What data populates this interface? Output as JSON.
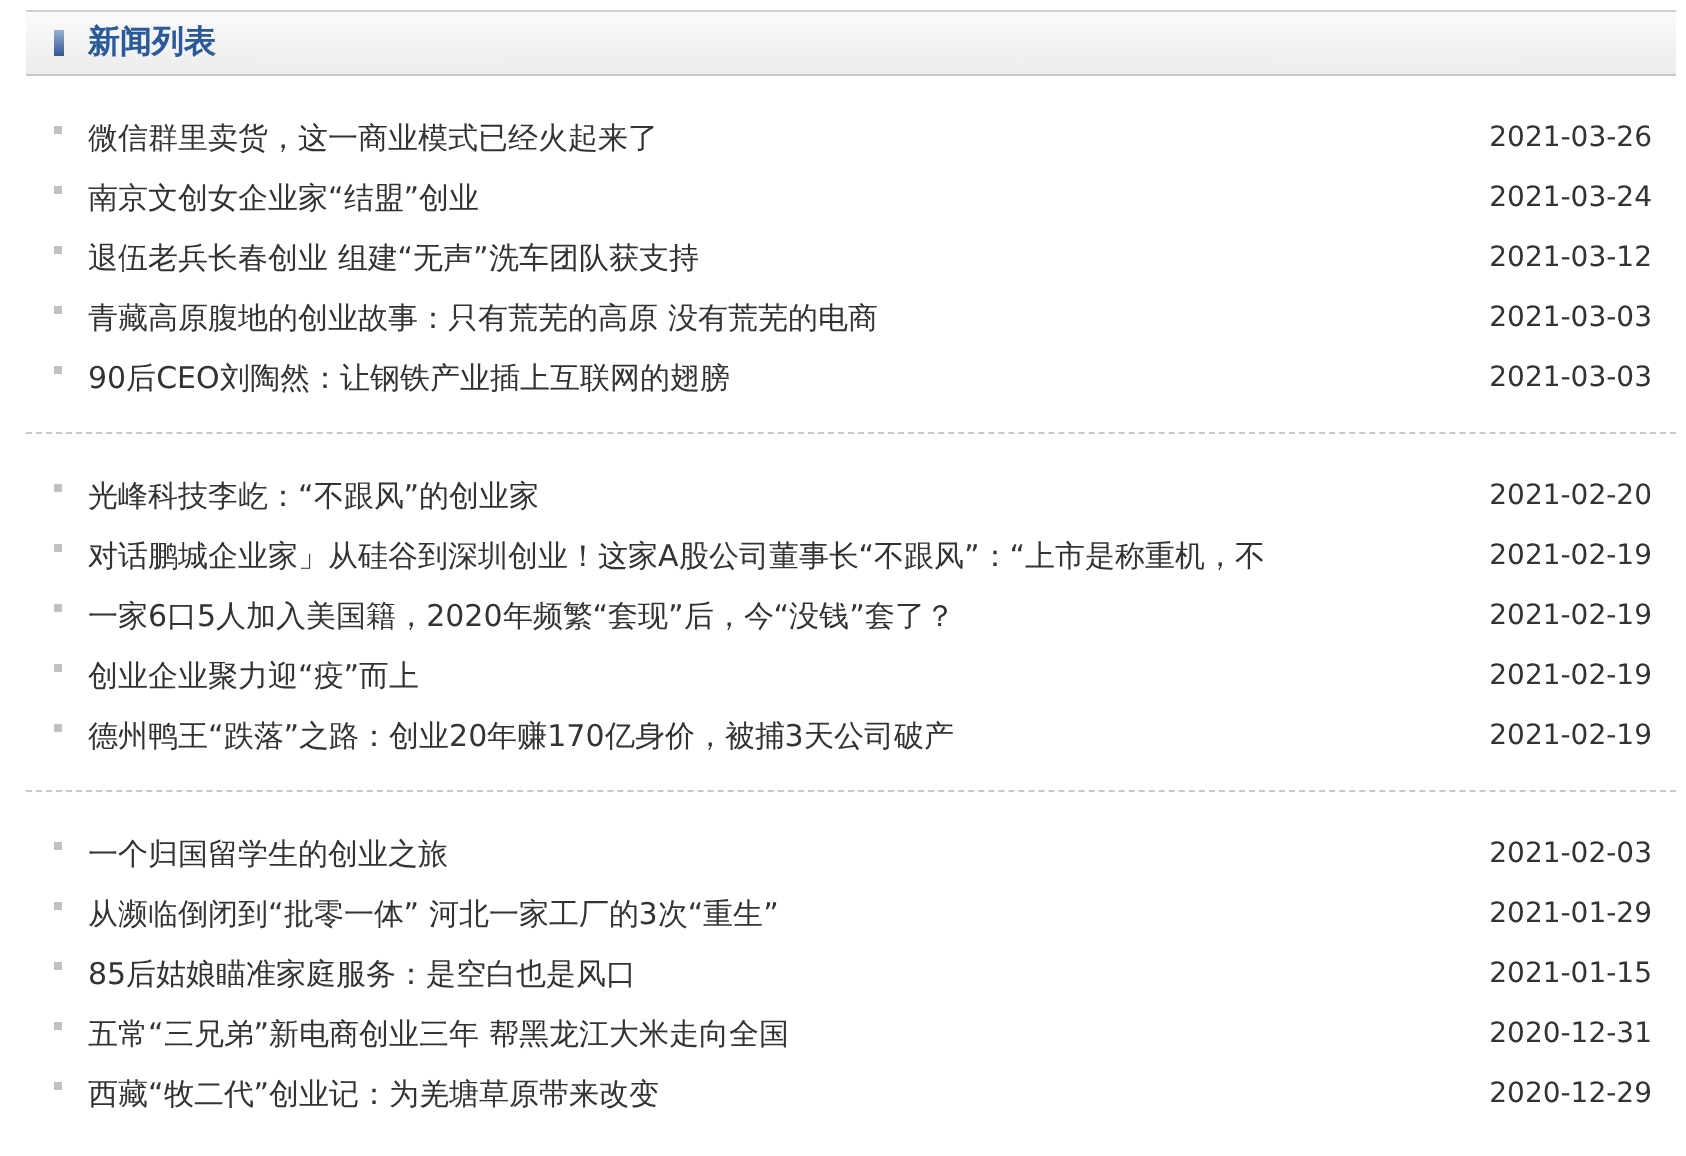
{
  "header": {
    "title": "新闻列表"
  },
  "groups": [
    {
      "items": [
        {
          "title": "微信群里卖货，这一商业模式已经火起来了",
          "date": "2021-03-26"
        },
        {
          "title": "南京文创女企业家“结盟”创业",
          "date": "2021-03-24"
        },
        {
          "title": "退伍老兵长春创业 组建“无声”洗车团队获支持",
          "date": "2021-03-12"
        },
        {
          "title": "青藏高原腹地的创业故事：只有荒芜的高原 没有荒芜的电商",
          "date": "2021-03-03"
        },
        {
          "title": "90后CEO刘陶然：让钢铁产业插上互联网的翅膀",
          "date": "2021-03-03"
        }
      ]
    },
    {
      "items": [
        {
          "title": "光峰科技李屹：“不跟风”的创业家",
          "date": "2021-02-20"
        },
        {
          "title": "对话鹏城企业家」从硅谷到深圳创业！这家A股公司董事长“不跟风”：“上市是称重机，不",
          "date": "2021-02-19"
        },
        {
          "title": "一家6口5人加入美国籍，2020年频繁“套现”后，今“没钱”套了？",
          "date": "2021-02-19"
        },
        {
          "title": "创业企业聚力迎“疫”而上",
          "date": "2021-02-19"
        },
        {
          "title": "德州鸭王“跌落”之路：创业20年赚170亿身价，被捕3天公司破产",
          "date": "2021-02-19"
        }
      ]
    },
    {
      "items": [
        {
          "title": "一个归国留学生的创业之旅",
          "date": "2021-02-03"
        },
        {
          "title": "从濒临倒闭到“批零一体” 河北一家工厂的3次“重生”",
          "date": "2021-01-29"
        },
        {
          "title": "85后姑娘瞄准家庭服务：是空白也是风口",
          "date": "2021-01-15"
        },
        {
          "title": "五常“三兄弟”新电商创业三年 帮黑龙江大米走向全国",
          "date": "2020-12-31"
        },
        {
          "title": "西藏“牧二代”创业记：为羌塘草原带来改变",
          "date": "2020-12-29"
        }
      ]
    }
  ]
}
